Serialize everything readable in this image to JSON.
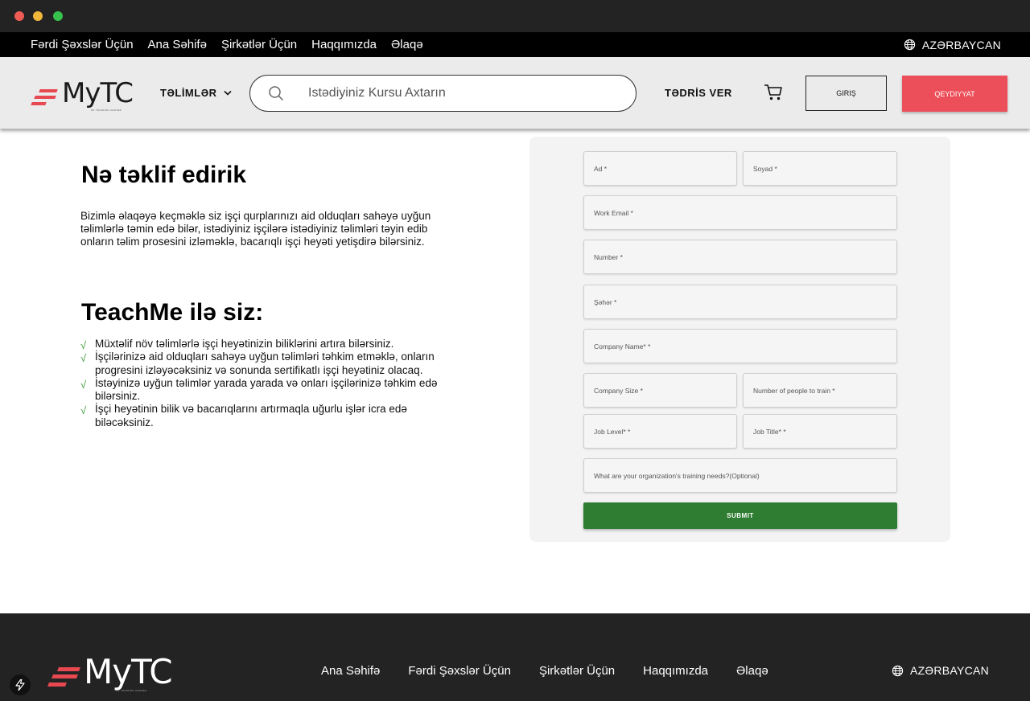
{
  "top_nav": {
    "links": [
      "Fərdi Şəxslər Üçün",
      "Ana Səhifə",
      "Şirkətlər Üçün",
      "Haqqımızda",
      "Əlaqə"
    ],
    "language": "AZƏRBAYCAN"
  },
  "header": {
    "logo_text": "MyTC",
    "logo_subtitle": "MY TRAINING CENTER",
    "courses_menu": "TƏLİMLƏR",
    "search_placeholder": "Istədiyiniz Kursu Axtarın",
    "teach": "TƏDRİS VER",
    "login": "GIRIŞ",
    "signup": "QEYDIYYAT"
  },
  "offer": {
    "title": "Nə təklif edirik",
    "text": "Bizimlə əlaqəyə keçməklə siz işçi qurplarınızı aid olduqları sahəyə uyğun təlimlərlə təmin edə bilər, istədiyiniz işçilərə istədiyiniz təlimləri təyin edib onların təlim prosesini izləməklə, bacarıqlı işçi heyəti yetişdirə bilərsiniz."
  },
  "teachme": {
    "title": "TeachMe ilə siz:",
    "check": "√",
    "benefits": [
      "Müxtəlif növ təlimlərlə işçi heyətinizin biliklərini artıra bilərsiniz.",
      "İşçilərinizə aid olduqları sahəyə uyğun təlimləri təhkim etməklə, onların progresini izləyəcəksiniz və sonunda sertifikatlı işçi heyətiniz olacaq.",
      "İstəyinizə uyğun təlimlər yarada yarada və onları işçilərinizə təhkim edə bilərsiniz.",
      "İşçi heyətinin bilik və bacarıqlarını artırmaqla uğurlu işlər icra edə biləcəksiniz."
    ]
  },
  "form": {
    "first_name": "Ad *",
    "last_name": "Soyad *",
    "work_email": "Work Email *",
    "number": "Number *",
    "city": "Şəhər *",
    "company_name": "Company Name* *",
    "company_size": "Company Size *",
    "people_to_train": "Number of people to train *",
    "job_level": "Job Level* *",
    "job_title": "Job Title* *",
    "training_needs": "What are your organization's training needs?(Optional)",
    "submit": "SUBMIT"
  },
  "footer": {
    "logo_text": "MyTC",
    "logo_subtitle": "MY TRAINING CENTER",
    "links": [
      "Ana Səhifə",
      "Fərdi Şəxslər Üçün",
      "Şirkətlər Üçün",
      "Haqqımızda",
      "Əlaqə"
    ],
    "language": "AZƏRBAYCAN"
  },
  "colors": {
    "brand_red": "#e8484f",
    "signup_red": "#ec4f59",
    "submit_green": "#2e7d32",
    "footer_bg": "#232323"
  }
}
